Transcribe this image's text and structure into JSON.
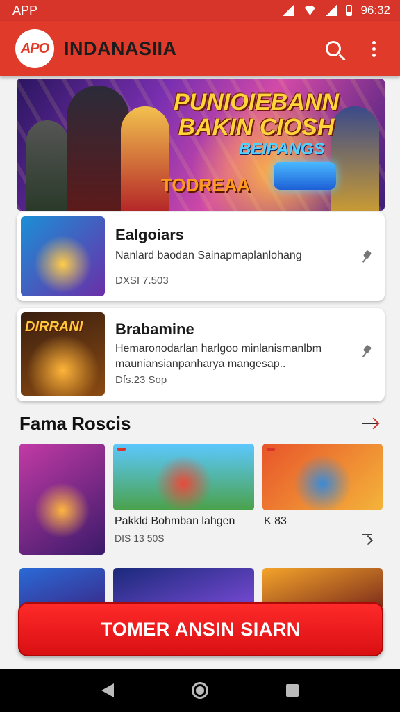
{
  "status_bar": {
    "carrier": "APP",
    "time": "96:32"
  },
  "app_bar": {
    "logo_text": "APO",
    "title": "INDANASIIA"
  },
  "banner": {
    "title_line1": "PUNIOIEBANN",
    "title_line2": "BAKIN CIOSH",
    "subtitle": "BEIPANGS",
    "logo_text": "TODREAA"
  },
  "featured": [
    {
      "title": "Ealgoiars",
      "description": "Nanlard baodan Sainapmaplanlohang",
      "meta": "DXSI 7.503"
    },
    {
      "title": "Brabamine",
      "description": "Hemaronodarlan harlgoo minlanismanlbm mauniansianpanharya mangesap..",
      "meta": "Dfs.23 Sop",
      "thumb_text": "DIRRANI"
    }
  ],
  "section": {
    "title": "Fama Roscis"
  },
  "tiles": [
    {
      "caption": "Pakkld Bohmban lahgen",
      "meta": "DIS 13 50S"
    },
    {
      "caption": "K 83"
    }
  ],
  "cta": {
    "label": "TOMER ANSIN SIARN"
  },
  "colors": {
    "brand_red": "#e03a2a",
    "cta_red": "#ff2a2a"
  }
}
